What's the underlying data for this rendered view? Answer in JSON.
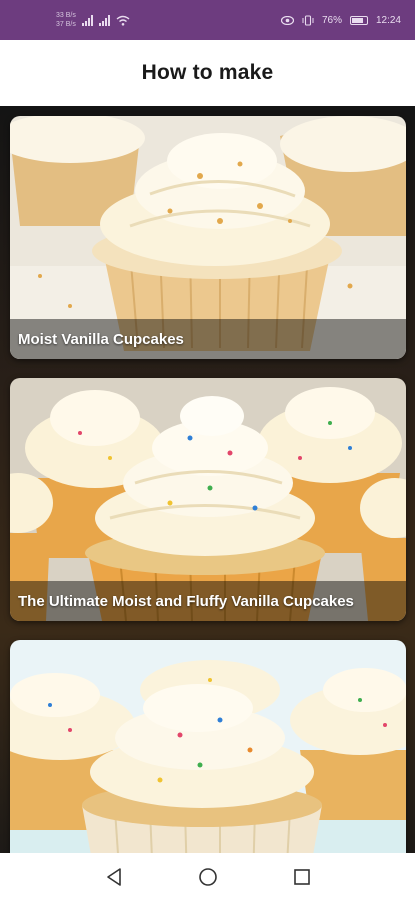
{
  "status_bar": {
    "net_speed_top": "33 B/s",
    "net_speed_bottom": "37 B/s",
    "battery_percent": "76%",
    "time": "12:24"
  },
  "app_bar": {
    "title": "How to make"
  },
  "recipes": [
    {
      "title": "Moist Vanilla Cupcakes"
    },
    {
      "title": "The Ultimate Moist and Fluffy Vanilla Cupcakes"
    },
    {
      "title": ""
    }
  ],
  "icons": {
    "back": "back-icon",
    "home": "home-icon",
    "recents": "recents-icon"
  },
  "colors": {
    "status_bar": "#6d3c7f",
    "app_bar": "#ffffff",
    "frosting": "#fbf3dc",
    "cake": "#e8b86c"
  }
}
